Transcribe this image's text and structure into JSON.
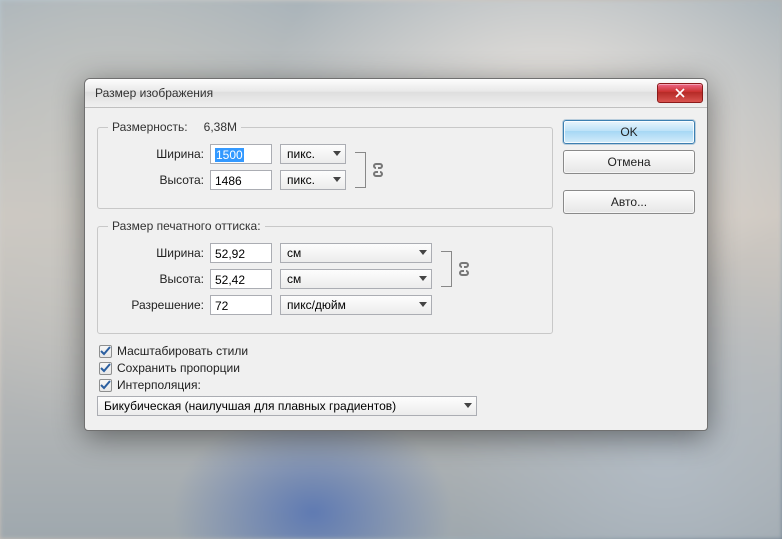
{
  "title": "Размер изображения",
  "buttons": {
    "ok": "OK",
    "cancel": "Отмена",
    "auto": "Авто..."
  },
  "dim": {
    "label": "Размерность:",
    "value": "6,38M"
  },
  "pixel": {
    "width_label": "Ширина:",
    "width_value": "1500",
    "height_label": "Высота:",
    "height_value": "1486",
    "unit": "пикс."
  },
  "print": {
    "legend": "Размер печатного оттиска:",
    "width_label": "Ширина:",
    "width_value": "52,92",
    "height_label": "Высота:",
    "height_value": "52,42",
    "unit": "см",
    "res_label": "Разрешение:",
    "res_value": "72",
    "res_unit": "пикс/дюйм"
  },
  "checks": {
    "scale_styles": "Масштабировать стили",
    "constrain": "Сохранить пропорции",
    "resample": "Интерполяция:"
  },
  "interp": "Бикубическая (наилучшая для плавных градиентов)"
}
